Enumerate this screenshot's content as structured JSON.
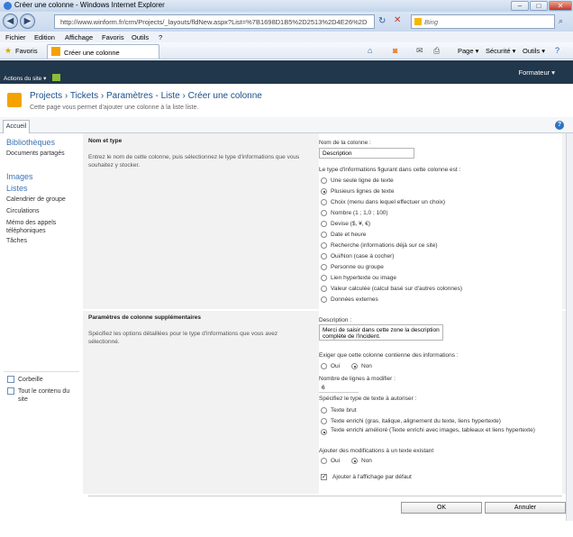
{
  "window": {
    "title": "Créer une colonne - Windows Internet Explorer",
    "url": "http://www.winform.fr/crm/Projects/_layouts/fldNew.aspx?List=%7B1698D1B5%2D2513%2D4E26%2D4",
    "search_placeholder": "Bing"
  },
  "menu": [
    "Fichier",
    "Edition",
    "Affichage",
    "Favoris",
    "Outils",
    "?"
  ],
  "favbar": {
    "favorites_label": "Favoris",
    "tab_label": "Créer une colonne",
    "page_label": "Page ▾",
    "security_label": "Sécurité ▾",
    "tools_label": "Outils ▾"
  },
  "sp": {
    "user": "Formateur ▾",
    "actions": "Actions du site ▾",
    "breadcrumb": "Projects  ›  Tickets  ›  Paramètres - Liste  ›  Créer une colonne",
    "description": "Cette page vous permet d'ajouter une colonne à la liste liste.",
    "ribbon_tab": "Accueil"
  },
  "quicklaunch": {
    "h1": "Bibliothèques",
    "i1": "Documents partagés",
    "h2": "Images",
    "h3": "Listes",
    "i2": "Calendrier de groupe",
    "i3": "Circulations",
    "i4": "Mémo des appels téléphoniques",
    "i5": "Tâches",
    "recycle": "Corbeille",
    "allcontent": "Tout le contenu du site"
  },
  "form": {
    "sec1_title": "Nom et type",
    "sec1_desc": "Entrez le nom de cette colonne, puis sélectionnez le type d'informations que vous souhaitez y stocker.",
    "name_label": "Nom de la colonne :",
    "name_value": "Description",
    "type_label": "Le type d'informations figurant dans cette colonne est :",
    "types": [
      "Une seule ligne de texte",
      "Plusieurs lignes de texte",
      "Choix (menu dans lequel effectuer un choix)",
      "Nombre (1 ; 1,0 ; 100)",
      "Devise ($, ¥, €)",
      "Date et heure",
      "Recherche (informations déjà sur ce site)",
      "Oui/Non (case à cocher)",
      "Personne ou groupe",
      "Lien hypertexte ou image",
      "Valeur calculée (calcul basé sur d'autres colonnes)",
      "Données externes"
    ],
    "sec2_title": "Paramètres de colonne supplémentaires",
    "sec2_desc": "Spécifiez les options détaillées pour le type d'informations que vous avez sélectionné.",
    "desc_label": "Description :",
    "desc_value": "Merci de saisir dans cette zone la description complète de l'incident.",
    "required_label": "Exiger que cette colonne contienne des informations :",
    "yes": "Oui",
    "no": "Non",
    "lines_label": "Nombre de lignes à modifier :",
    "lines_value": "6",
    "texttype_label": "Spécifiez le type de texte à autoriser :",
    "texttypes": [
      "Texte brut",
      "Texte enrichi (gras, italique, alignement du texte, liens hypertexte)",
      "Texte enrichi amélioré (Texte enrichi avec images, tableaux et liens hypertexte)"
    ],
    "append_label": "Ajouter des modifications à un texte existant",
    "default_view_label": "Ajouter à l'affichage par défaut",
    "ok": "OK",
    "cancel": "Annuler"
  }
}
